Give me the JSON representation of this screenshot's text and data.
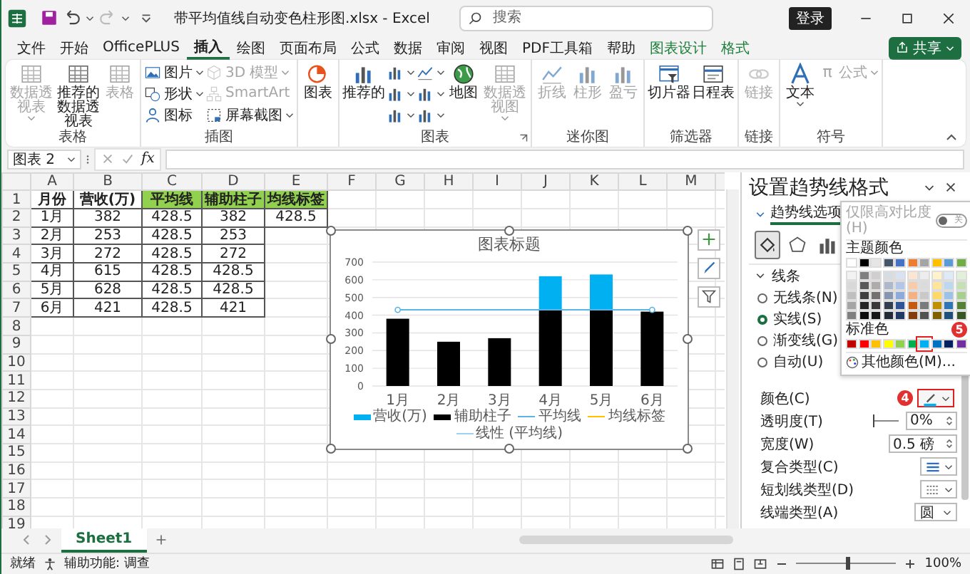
{
  "title_bar": {
    "file_title": "带平均值线自动变色柱形图.xlsx - Excel",
    "search": {
      "placeholder": "搜索"
    },
    "sign_in": "登录"
  },
  "menu": {
    "tabs": [
      {
        "label": "文件",
        "selected": false,
        "contextual": false
      },
      {
        "label": "开始",
        "selected": false,
        "contextual": false
      },
      {
        "label": "OfficePLUS",
        "selected": false,
        "contextual": false
      },
      {
        "label": "插入",
        "selected": true,
        "contextual": false
      },
      {
        "label": "绘图",
        "selected": false,
        "contextual": false
      },
      {
        "label": "页面布局",
        "selected": false,
        "contextual": false
      },
      {
        "label": "公式",
        "selected": false,
        "contextual": false
      },
      {
        "label": "数据",
        "selected": false,
        "contextual": false
      },
      {
        "label": "审阅",
        "selected": false,
        "contextual": false
      },
      {
        "label": "视图",
        "selected": false,
        "contextual": false
      },
      {
        "label": "PDF工具箱",
        "selected": false,
        "contextual": false
      },
      {
        "label": "帮助",
        "selected": false,
        "contextual": false
      },
      {
        "label": "图表设计",
        "selected": false,
        "contextual": true
      },
      {
        "label": "格式",
        "selected": false,
        "contextual": true
      }
    ],
    "share": "共享"
  },
  "ribbon": {
    "groups": [
      {
        "label": "表格",
        "items": [
          {
            "label": "数据透视表",
            "kind": "large",
            "disabled": true,
            "dropdown": true
          },
          {
            "label": "推荐的数据透视表",
            "kind": "large",
            "disabled": false
          },
          {
            "label": "表格",
            "kind": "large",
            "disabled": true
          }
        ]
      },
      {
        "label": "插图",
        "items": [
          {
            "label": "图片",
            "kind": "small",
            "disabled": false,
            "dropdown": true
          },
          {
            "label": "形状",
            "kind": "small",
            "disabled": false,
            "dropdown": true
          },
          {
            "label": "图标",
            "kind": "small",
            "disabled": false
          },
          {
            "label": "3D 模型",
            "kind": "small",
            "disabled": true,
            "dropdown": true
          },
          {
            "label": "SmartArt",
            "kind": "small",
            "disabled": true
          },
          {
            "label": "屏幕截图",
            "kind": "small",
            "disabled": false,
            "dropdown": true
          }
        ]
      },
      {
        "items": [
          {
            "label": "图表",
            "kind": "large",
            "disabled": false
          }
        ]
      },
      {
        "label": "图表",
        "launcher": true,
        "items": [
          {
            "label": "推荐的",
            "kind": "large",
            "disabled": false
          },
          {
            "kind": "small",
            "disabled": false,
            "dropdown": true
          },
          {
            "kind": "small",
            "disabled": false,
            "dropdown": true
          },
          {
            "kind": "small",
            "disabled": false,
            "dropdown": true
          },
          {
            "kind": "small",
            "disabled": false,
            "dropdown": true
          },
          {
            "kind": "small",
            "disabled": false,
            "dropdown": true
          },
          {
            "kind": "small",
            "disabled": false,
            "dropdown": true
          },
          {
            "label": "地图",
            "kind": "large",
            "disabled": false
          },
          {
            "label": "数据透视图",
            "kind": "large",
            "disabled": true,
            "dropdown": true
          }
        ]
      },
      {
        "label": "迷你图",
        "items": [
          {
            "label": "折线",
            "kind": "large",
            "disabled": true
          },
          {
            "label": "柱形",
            "kind": "large",
            "disabled": true
          },
          {
            "label": "盈亏",
            "kind": "large",
            "disabled": true
          }
        ]
      },
      {
        "label": "筛选器",
        "items": [
          {
            "label": "切片器",
            "kind": "large",
            "disabled": false
          },
          {
            "label": "日程表",
            "kind": "large",
            "disabled": false
          }
        ]
      },
      {
        "label": "链接",
        "items": [
          {
            "label": "链接",
            "kind": "large",
            "disabled": true
          }
        ]
      },
      {
        "label": "符号",
        "items": [
          {
            "label": "文本",
            "kind": "large",
            "disabled": false,
            "dropdown": true
          },
          {
            "label": "公式",
            "glyph": "π",
            "kind": "small",
            "disabled": true,
            "dropdown": true
          }
        ]
      }
    ]
  },
  "formula_bar": {
    "name_box": "图表 2",
    "function_label": "fx"
  },
  "sheet": {
    "columns": [
      "A",
      "B",
      "C",
      "D",
      "E",
      "F",
      "G",
      "H",
      "I",
      "J",
      "K",
      "L",
      "M"
    ],
    "row_numbers": [
      "1",
      "2",
      "3",
      "4",
      "5",
      "6",
      "7",
      "8",
      "9",
      "10",
      "11",
      "12",
      "13",
      "14",
      "15",
      "16",
      "17",
      "18",
      "19"
    ],
    "header": [
      {
        "text": "月份",
        "color": "#ffffff"
      },
      {
        "text": "营收(万)",
        "color": "#ffffff"
      },
      {
        "text": "平均线",
        "color": "#92d050"
      },
      {
        "text": "辅助柱子",
        "color": "#92d050"
      },
      {
        "text": "均线标签",
        "color": "#92d050"
      }
    ],
    "rows": [
      [
        "1月",
        "382",
        "428.5",
        "382",
        "428.5"
      ],
      [
        "2月",
        "253",
        "428.5",
        "253"
      ],
      [
        "3月",
        "272",
        "428.5",
        "272"
      ],
      [
        "4月",
        "615",
        "428.5",
        "428.5"
      ],
      [
        "5月",
        "628",
        "428.5",
        "428.5"
      ],
      [
        "6月",
        "421",
        "428.5",
        "421"
      ]
    ]
  },
  "chart": {
    "selected": true,
    "chart_data": {
      "type": "bar",
      "title": "图表标题",
      "categories": [
        "1月",
        "2月",
        "3月",
        "4月",
        "5月",
        "6月"
      ],
      "series": [
        {
          "name": "营收(万)",
          "color": "#00b0f0",
          "type": "bar",
          "values": [
            0,
            0,
            0,
            190,
            200,
            0
          ]
        },
        {
          "name": "辅助柱子",
          "color": "#000000",
          "type": "bar",
          "values": [
            380,
            250,
            270,
            430,
            430,
            420
          ]
        },
        {
          "name": "平均线",
          "color": "#5ab4e6",
          "type": "line",
          "values": [
            430,
            430,
            430,
            430,
            430,
            430
          ]
        }
      ],
      "ylim": [
        0,
        700
      ],
      "yticks": [
        0,
        100,
        200,
        300,
        400,
        500,
        600,
        700
      ],
      "stacked": true,
      "grid": true
    },
    "legend": [
      {
        "label": "均线标签",
        "color": "#ffc000"
      },
      {
        "label": "线性 (平均线)",
        "color": "#9dd3f0"
      }
    ]
  },
  "sheet_tabs": [
    {
      "label": "Sheet1",
      "selected": true
    }
  ],
  "status_bar": {
    "ready": "就绪",
    "accessibility": "辅助功能: 调查",
    "zoom": "100%",
    "level": 0.5
  },
  "format_pane": {
    "title": "设置趋势线格式",
    "tab": "趋势线选项",
    "icon_tabs": [
      {
        "selected": true
      },
      {
        "selected": false
      },
      {
        "selected": false
      }
    ],
    "section": "线条",
    "expanded": true,
    "line_options": [
      {
        "label": "无线条(N)",
        "selected": false
      },
      {
        "label": "实线(S)",
        "selected": true
      },
      {
        "label": "渐变线(G)",
        "selected": false
      },
      {
        "label": "自动(U)",
        "selected": false
      }
    ],
    "properties": [
      {
        "kind": "color",
        "label": "颜色(C)",
        "color": "#00b0f0",
        "highlighted": true,
        "badge": "4"
      },
      {
        "kind": "slider",
        "label": "透明度(T)",
        "value": "0%",
        "level": 0
      },
      {
        "kind": "spinner",
        "label": "宽度(W)",
        "value": "0.5 磅"
      },
      {
        "kind": "compound",
        "label": "复合类型(C)"
      },
      {
        "kind": "dash",
        "label": "短划线类型(D)"
      },
      {
        "kind": "dropdown",
        "label": "线端类型(A)",
        "value": "圆"
      }
    ],
    "color_picker": {
      "high_contrast": "仅限高对比度(H)",
      "toggle": "关",
      "toggle_on": false,
      "theme_title": "主题颜色",
      "theme_rows": [
        [
          {
            "color": "#ffffff",
            "selected": false
          },
          {
            "color": "#000000",
            "selected": false
          },
          {
            "color": "#e7e6e6",
            "selected": false
          },
          {
            "color": "#44546a",
            "selected": false
          },
          {
            "color": "#4472c4",
            "selected": false
          },
          {
            "color": "#ed7d31",
            "selected": false
          },
          {
            "color": "#a5a5a5",
            "selected": false
          },
          {
            "color": "#ffc000",
            "selected": false
          },
          {
            "color": "#5b9bd5",
            "selected": false
          },
          {
            "color": "#70ad47",
            "selected": false
          }
        ],
        [
          {
            "color": "#f2f2f2",
            "selected": false
          },
          {
            "color": "#7f7f7f",
            "selected": false
          },
          {
            "color": "#d0cece",
            "selected": false
          },
          {
            "color": "#d6dce4",
            "selected": false
          },
          {
            "color": "#d9e2f3",
            "selected": false
          },
          {
            "color": "#fbe5d5",
            "selected": false
          },
          {
            "color": "#ededed",
            "selected": false
          },
          {
            "color": "#fff2cc",
            "selected": false
          },
          {
            "color": "#deebf6",
            "selected": false
          },
          {
            "color": "#e2efd9",
            "selected": false
          }
        ],
        [
          {
            "color": "#d8d8d8",
            "selected": false
          },
          {
            "color": "#595959",
            "selected": false
          },
          {
            "color": "#aeabab",
            "selected": false
          },
          {
            "color": "#adb9ca",
            "selected": false
          },
          {
            "color": "#b4c6e7",
            "selected": false
          },
          {
            "color": "#f7cbac",
            "selected": false
          },
          {
            "color": "#dbdbdb",
            "selected": false
          },
          {
            "color": "#fee599",
            "selected": false
          },
          {
            "color": "#bdd7ee",
            "selected": false
          },
          {
            "color": "#c5e0b3",
            "selected": false
          }
        ],
        [
          {
            "color": "#bfbfbf",
            "selected": false
          },
          {
            "color": "#3f3f3f",
            "selected": false
          },
          {
            "color": "#757070",
            "selected": false
          },
          {
            "color": "#8496b0",
            "selected": false
          },
          {
            "color": "#8eaadb",
            "selected": false
          },
          {
            "color": "#f4b183",
            "selected": false
          },
          {
            "color": "#c9c9c9",
            "selected": false
          },
          {
            "color": "#ffd965",
            "selected": false
          },
          {
            "color": "#9cc3e5",
            "selected": false
          },
          {
            "color": "#a8d08d",
            "selected": false
          }
        ],
        [
          {
            "color": "#a5a5a5",
            "selected": false
          },
          {
            "color": "#262626",
            "selected": false
          },
          {
            "color": "#3a3838",
            "selected": false
          },
          {
            "color": "#323f4f",
            "selected": false
          },
          {
            "color": "#2f5496",
            "selected": false
          },
          {
            "color": "#c55a11",
            "selected": false
          },
          {
            "color": "#7b7b7b",
            "selected": false
          },
          {
            "color": "#bf9000",
            "selected": false
          },
          {
            "color": "#2e75b5",
            "selected": false
          },
          {
            "color": "#538135",
            "selected": false
          }
        ],
        [
          {
            "color": "#7f7f7f",
            "selected": false
          },
          {
            "color": "#0c0c0c",
            "selected": false
          },
          {
            "color": "#171616",
            "selected": false
          },
          {
            "color": "#222a35",
            "selected": false
          },
          {
            "color": "#1f3864",
            "selected": false
          },
          {
            "color": "#833c0b",
            "selected": false
          },
          {
            "color": "#525252",
            "selected": false
          },
          {
            "color": "#7f6000",
            "selected": false
          },
          {
            "color": "#1e4e79",
            "selected": false
          },
          {
            "color": "#375623",
            "selected": false
          }
        ]
      ],
      "standard_title": "标准色",
      "badge": "5",
      "standard": [
        {
          "color": "#c00000",
          "selected": false
        },
        {
          "color": "#ff0000",
          "selected": false
        },
        {
          "color": "#ffc000",
          "selected": false
        },
        {
          "color": "#ffff00",
          "selected": false
        },
        {
          "color": "#92d050",
          "selected": false
        },
        {
          "color": "#00b050",
          "selected": false
        },
        {
          "color": "#00b0f0",
          "selected": true
        },
        {
          "color": "#0070c0",
          "selected": false
        },
        {
          "color": "#002060",
          "selected": false
        },
        {
          "color": "#7030a0",
          "selected": false
        }
      ],
      "more": "其他颜色(M)..."
    }
  }
}
